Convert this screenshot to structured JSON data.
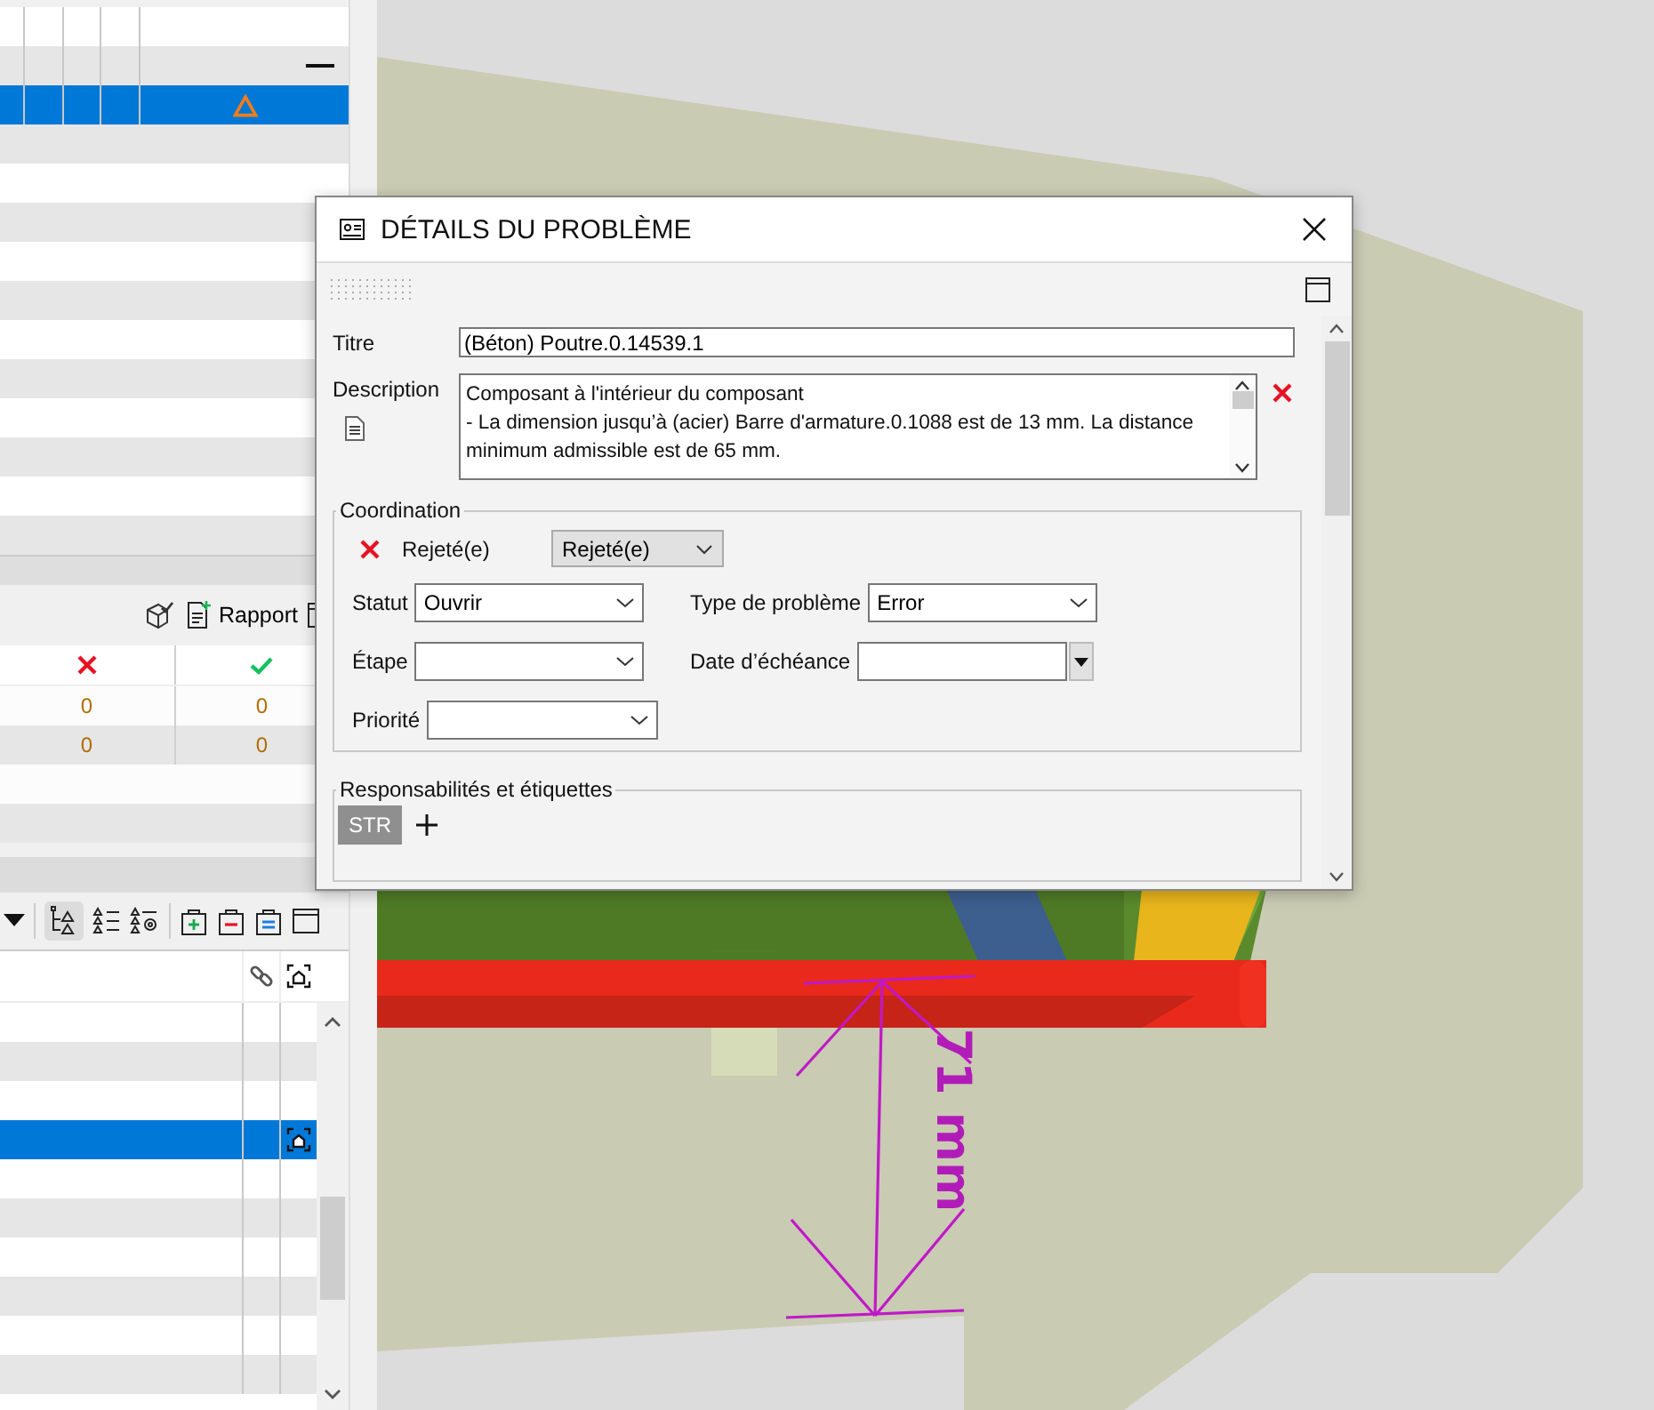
{
  "left_panel": {
    "top_table": {
      "rows": [
        {
          "kind": "empty",
          "selected": false
        },
        {
          "kind": "minus",
          "selected": false
        },
        {
          "kind": "warning",
          "selected": true
        },
        {
          "kind": "empty",
          "selected": false
        },
        {
          "kind": "empty",
          "selected": false
        },
        {
          "kind": "empty",
          "selected": false
        },
        {
          "kind": "empty",
          "selected": false
        },
        {
          "kind": "empty",
          "selected": false
        },
        {
          "kind": "empty",
          "selected": false
        },
        {
          "kind": "empty",
          "selected": false
        },
        {
          "kind": "empty",
          "selected": false
        },
        {
          "kind": "empty",
          "selected": false
        },
        {
          "kind": "empty",
          "selected": false
        },
        {
          "kind": "empty",
          "selected": false
        }
      ]
    },
    "toolbar": {
      "report_button": "Rapport"
    },
    "counts_table": {
      "columns": [
        {
          "kind": "rejected"
        },
        {
          "kind": "approved"
        }
      ],
      "rows": [
        [
          "0",
          "0"
        ],
        [
          "0",
          "0"
        ]
      ]
    },
    "issues_table": {
      "rows": [
        {
          "selected": false,
          "focus": false
        },
        {
          "selected": false,
          "focus": false
        },
        {
          "selected": false,
          "focus": false
        },
        {
          "selected": true,
          "focus": true
        },
        {
          "selected": false,
          "focus": false
        },
        {
          "selected": false,
          "focus": false
        },
        {
          "selected": false,
          "focus": false
        },
        {
          "selected": false,
          "focus": false
        },
        {
          "selected": false,
          "focus": false
        },
        {
          "selected": false,
          "focus": false
        }
      ]
    }
  },
  "dialog": {
    "title": "DÉTAILS DU PROBLÈME",
    "title_field": {
      "label": "Titre",
      "value": "(Béton) Poutre.0.14539.1"
    },
    "description": {
      "label": "Description",
      "lines": [
        "Composant à l'intérieur du composant",
        "- La dimension jusqu’à (acier) Barre d'armature.0.1088 est de 13 mm. La distance minimum admissible est de 65 mm."
      ]
    },
    "coordination": {
      "title": "Coordination",
      "status_label": "Rejeté(e)",
      "status_select": "Rejeté(e)",
      "fields": [
        {
          "label": "Statut",
          "value": "Ouvrir"
        },
        {
          "label": "Type de problème",
          "value": "Error"
        },
        {
          "label": "Étape"
        },
        {
          "label": "Date d’échéance",
          "kind": "date"
        },
        {
          "label": "Priorité"
        }
      ]
    },
    "responsibilities": {
      "title": "Responsabilités et étiquettes",
      "tags": [
        "STR"
      ]
    }
  },
  "viewport": {
    "dimension_label": "71 mm"
  }
}
